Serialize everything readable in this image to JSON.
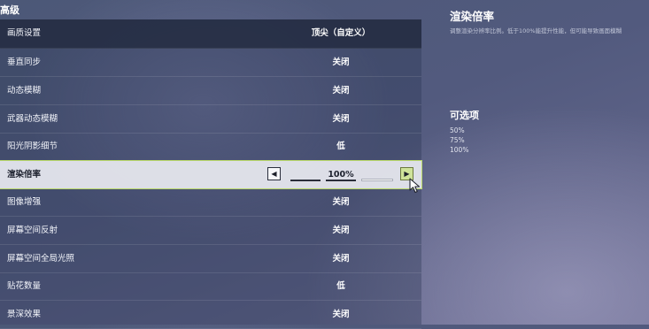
{
  "section_title": "高级",
  "table": {
    "header": {
      "label": "画质设置",
      "value": "顶尖（自定义）"
    },
    "rows": [
      {
        "label": "垂直同步",
        "value": "关闭"
      },
      {
        "label": "动态模糊",
        "value": "关闭"
      },
      {
        "label": "武器动态模糊",
        "value": "关闭"
      },
      {
        "label": "阳光阴影细节",
        "value": "低"
      },
      {
        "label": "渲染倍率",
        "value": "100%"
      },
      {
        "label": "图像增强",
        "value": "关闭"
      },
      {
        "label": "屏幕空间反射",
        "value": "关闭"
      },
      {
        "label": "屏幕空间全局光照",
        "value": "关闭"
      },
      {
        "label": "贴花数量",
        "value": "低"
      },
      {
        "label": "景深效果",
        "value": "关闭"
      }
    ],
    "selected_row_index": 4,
    "stepper": {
      "current_step": 2,
      "total_steps": 3
    }
  },
  "info": {
    "title": "渲染倍率",
    "description": "调整渲染分辨率比例。低于100%能提升性能，但可能导致画面模糊",
    "options_title": "可选项",
    "options": [
      "50%",
      "75%",
      "100%"
    ]
  },
  "colors": {
    "selected_row_bg": "#e8eaf0",
    "selected_outline": "#b9d86a",
    "stepper_active": "#cfe39a"
  },
  "icons": {
    "left_arrow": "chevron-left-icon",
    "right_arrow": "chevron-right-icon",
    "cursor": "mouse-pointer-icon"
  }
}
